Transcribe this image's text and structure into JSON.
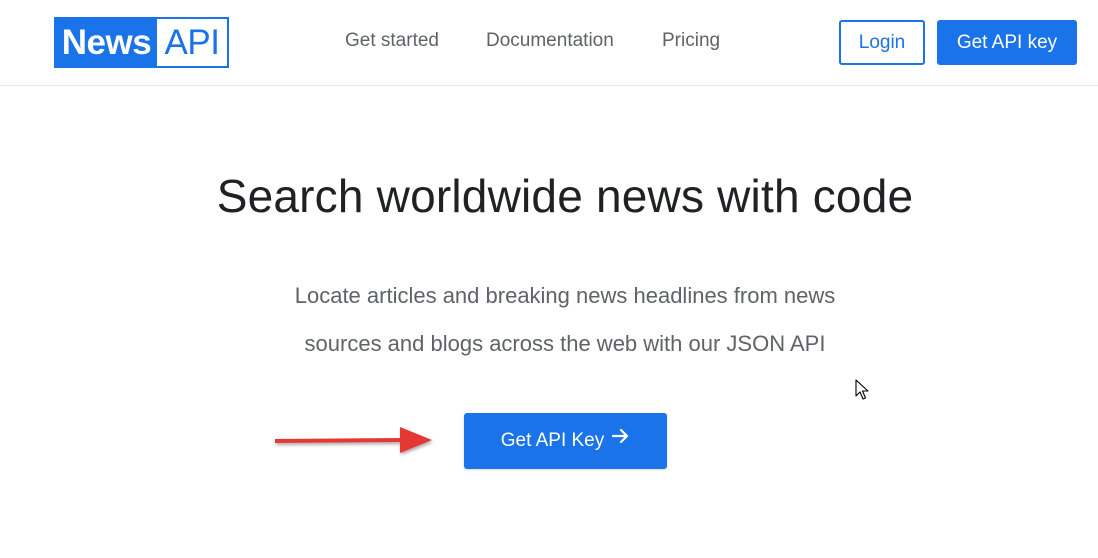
{
  "header": {
    "logo": {
      "left": "News",
      "right": "API"
    },
    "nav": [
      {
        "label": "Get started"
      },
      {
        "label": "Documentation"
      },
      {
        "label": "Pricing"
      }
    ],
    "login_label": "Login",
    "get_api_key_label": "Get API key"
  },
  "hero": {
    "title": "Search worldwide news with code",
    "subtitle_line1": "Locate articles and breaking news headlines from news",
    "subtitle_line2": "sources and blogs across the web with our JSON API",
    "cta_label": "Get API Key"
  },
  "colors": {
    "brand_blue": "#1a73e8",
    "annotation_red": "#e53935",
    "text_dark": "#202124",
    "text_gray": "#5f6368"
  },
  "icons": {
    "cta_icon": "arrow-right-icon",
    "annotation": "red-arrow-annotation-icon",
    "cursor": "mouse-cursor-icon"
  }
}
